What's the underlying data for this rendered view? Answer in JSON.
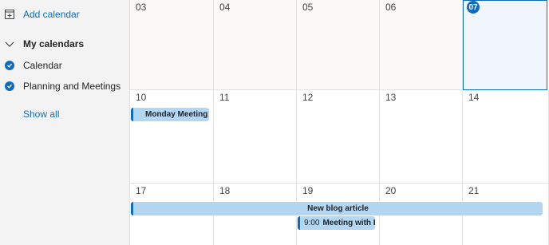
{
  "sidebar": {
    "add_calendar": "Add calendar",
    "my_calendars": "My calendars",
    "calendars": [
      {
        "label": "Calendar",
        "checked": true,
        "color": "#0f6cbd"
      },
      {
        "label": "Planning and Meetings",
        "checked": true,
        "color": "#0f6cbd"
      }
    ],
    "show_all": "Show all"
  },
  "weeks": [
    {
      "days": [
        "03",
        "04",
        "05",
        "06",
        "07"
      ]
    },
    {
      "days": [
        "10",
        "11",
        "12",
        "13",
        "14"
      ]
    },
    {
      "days": [
        "17",
        "18",
        "19",
        "20",
        "21"
      ]
    }
  ],
  "today": "07",
  "events": {
    "monday_meeting": {
      "title": "Monday Meeting"
    },
    "blog_article": {
      "title": "New blog article"
    },
    "meeting_kate": {
      "time": "9:00",
      "title": "Meeting with Kate"
    }
  },
  "colors": {
    "accent": "#0f6cbd",
    "event_fill": "#b3d6f2",
    "today_fill": "#f0f6fc"
  }
}
